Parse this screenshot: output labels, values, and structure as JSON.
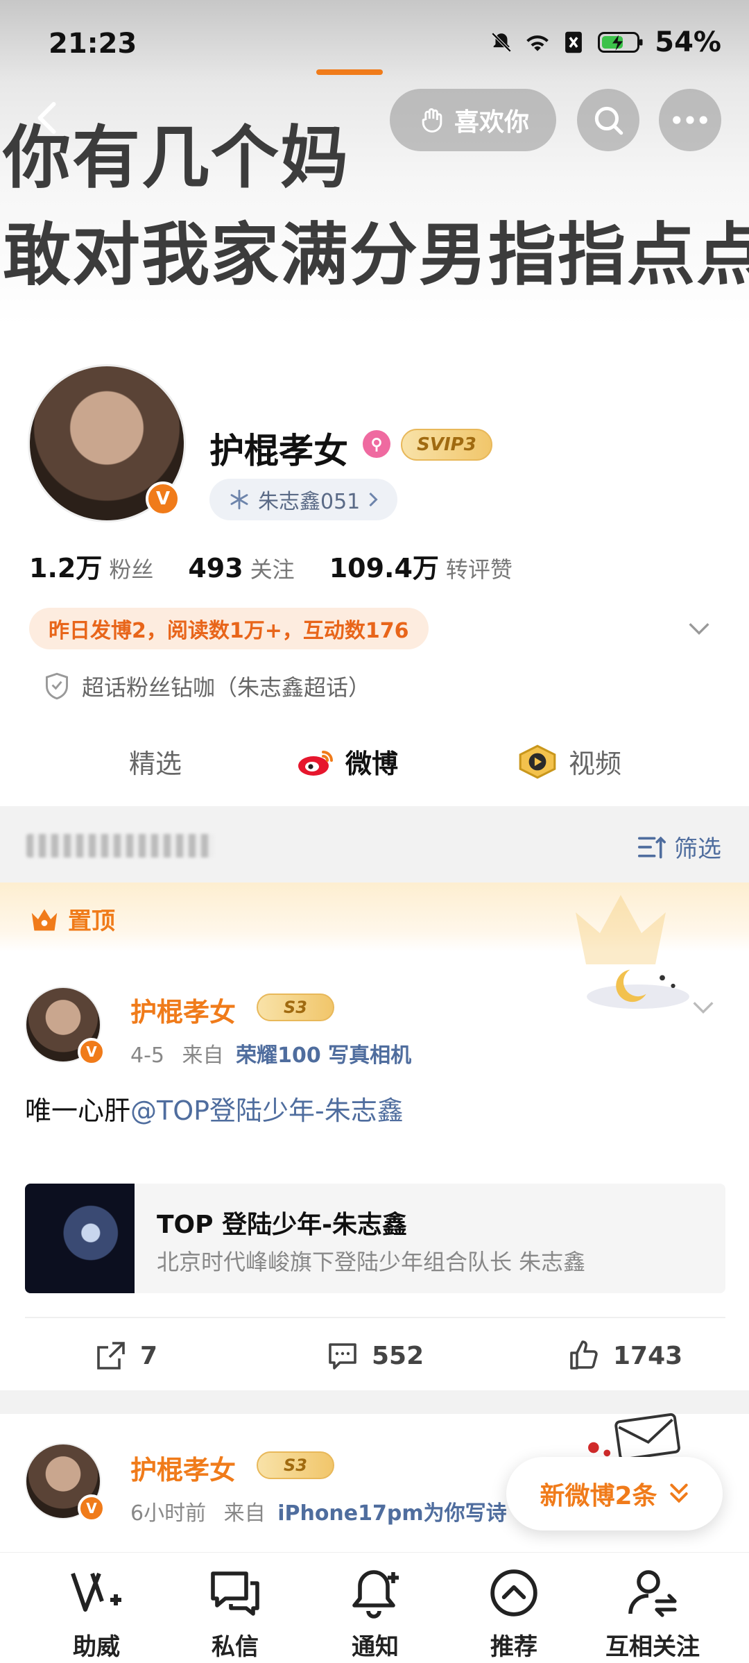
{
  "status_bar": {
    "time": "21:23",
    "battery": "54%"
  },
  "banner": {
    "line1": "你有几个妈",
    "line2": "敢对我家满分男指指点点"
  },
  "header_actions": {
    "like_label": "喜欢你"
  },
  "profile": {
    "name": "护棍孝女",
    "vip_badge": "SVIP3",
    "fandom_tag": "朱志鑫051",
    "stats": [
      {
        "value": "1.2万",
        "label": "粉丝"
      },
      {
        "value": "493",
        "label": "关注"
      },
      {
        "value": "109.4万",
        "label": "转评赞"
      }
    ],
    "activity": "昨日发博2，阅读数1万+，互动数176",
    "topic": "超话粉丝钻咖（朱志鑫超话）"
  },
  "tabs": [
    {
      "label": "精选"
    },
    {
      "label": "微博"
    },
    {
      "label": "视频"
    }
  ],
  "filter_label": "筛选",
  "pinned": {
    "label": "置顶",
    "post": {
      "author": "护棍孝女",
      "badge": "S3",
      "date": "4-5",
      "source_prefix": "来自",
      "source": "荣耀100 写真相机",
      "text_prefix": "唯一心肝",
      "mention": "@TOP登陆少年-朱志鑫",
      "card_title": "TOP 登陆少年-朱志鑫",
      "card_subtitle": "北京时代峰峻旗下登陆少年组合队长 朱志鑫",
      "reposts": "7",
      "comments": "552",
      "likes": "1743"
    }
  },
  "second_post": {
    "author": "护棍孝女",
    "badge": "S3",
    "time": "6小时前",
    "source_prefix": "来自",
    "source": "iPhone17pm为你写诗"
  },
  "new_posts": "新微博2条",
  "bottom_nav": [
    {
      "label": "助威"
    },
    {
      "label": "私信"
    },
    {
      "label": "通知"
    },
    {
      "label": "推荐"
    },
    {
      "label": "互相关注"
    }
  ],
  "colors": {
    "accent": "#f07b1a",
    "link": "#4f6d9e",
    "pink": "#ef6aa0"
  }
}
